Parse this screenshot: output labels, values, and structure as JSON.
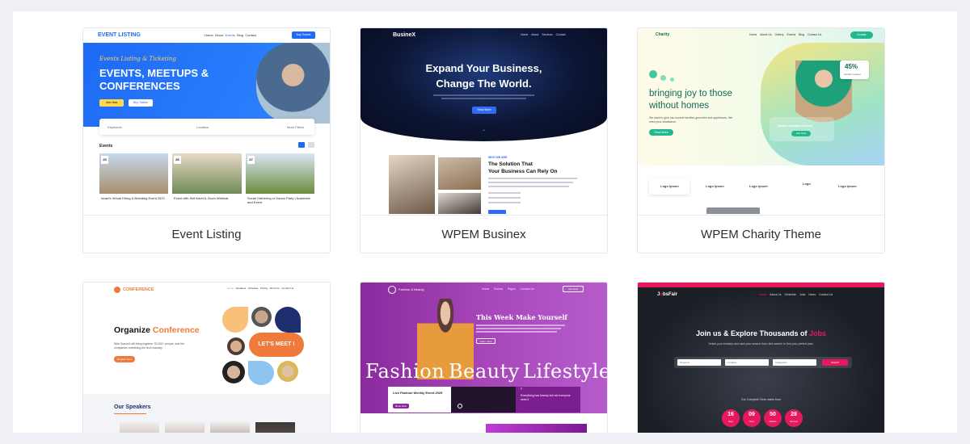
{
  "cards": [
    {
      "caption": "Event Listing",
      "logo": "EVENT LISTING",
      "nav": [
        "Home",
        "About",
        "Events",
        "Blog",
        "Contact"
      ],
      "nav_cta": "Buy Tickets",
      "tagline": "Events Listing & Ticketing",
      "headline": [
        "EVENTS, MEETUPS &",
        "CONFERENCES"
      ],
      "btn1": "Join Now",
      "btn2": "Buy Tickets",
      "search_keyword": "Keywords",
      "search_location": "Location",
      "search_filter": "More Filters",
      "section": "Events",
      "events": [
        {
          "day": "23",
          "title": "Israel's Virtual Hiring & Branding Event 2022"
        },
        {
          "day": "26",
          "title": "Event with Sell ticket & Zoom Webinar"
        },
        {
          "day": "27",
          "title": "Social Gathering or Dance Party | Academic and Event"
        }
      ]
    },
    {
      "caption": "WPEM Businex",
      "logo": "BusineX",
      "nav": [
        "Home",
        "About",
        "Services",
        "Contact"
      ],
      "headline": [
        "Expand Your Business,",
        "Change The World."
      ],
      "btn": "Read More",
      "eyebrow": "WHO WE ARE",
      "section_title": [
        "The Solution That",
        "Your Business Can Rely On"
      ]
    },
    {
      "caption": "WPEM Charity Theme",
      "logo": "Charity",
      "nav": [
        "Home",
        "About Us",
        "Gallery",
        "Events",
        "Blog",
        "Contact Us"
      ],
      "nav_cta": "Donate",
      "headline": [
        "bringing joy to those",
        "without homes"
      ],
      "sub": "We want to give low income families groceries and appliances. We need your assistance.",
      "btn": "Read More",
      "stat": "45%",
      "stat_label": "donation raised",
      "badge": "Online Donation Event",
      "badge_btn": "Join Now",
      "logos": [
        "Logo ipsum",
        "Logo ipsum",
        "Logo ipsum",
        "Logo",
        "Logo ipsum"
      ]
    },
    {
      "caption": "",
      "logo": "CONFERENCE",
      "nav": [
        "Home",
        "Speakers",
        "Schedule",
        "Pricing",
        "About Us",
        "Contact Us"
      ],
      "headline_a": "Organize",
      "headline_b": "Conference",
      "sub": "Web Summit will bring together 70,000+ people, and the companies redefining the tech industry.",
      "btn": "Register Now",
      "cta": "LET'S MEET !",
      "section": "Our Speakers"
    },
    {
      "caption": "",
      "logo": "Fashion & Beauty",
      "nav": [
        "Home",
        "Events",
        "Pages",
        "Contact Us"
      ],
      "nav_cta": "Join Now",
      "headline": "This Week Make Yourself",
      "btn": "Learn more",
      "big_words": [
        "Fashion",
        "Beauty",
        "Lifestyle"
      ],
      "event_title": "Live Fashion Weekly Event 2025",
      "event_btn": "Book Now",
      "quote": "Everything has beauty but not everyone sees it"
    },
    {
      "caption": "",
      "logo_a": "J",
      "logo_b": "bsFair",
      "nav": [
        "Home",
        "About Us",
        "Schedule",
        "Jobs",
        "News",
        "Contact Us"
      ],
      "headline_a": "Join us & Explore Thousands of",
      "headline_b": "Jobs",
      "sub": "Select your industry and start your search from click search to find your perfect jobs.",
      "fields": [
        "Keyword",
        "Location",
        "Categories"
      ],
      "search_btn": "Search",
      "countdown_label": "Our Complete Timer starts from",
      "countdown": [
        {
          "value": "16",
          "unit": "Days"
        },
        {
          "value": "09",
          "unit": "Hours"
        },
        {
          "value": "50",
          "unit": "Minutes"
        },
        {
          "value": "28",
          "unit": "Seconds"
        }
      ]
    }
  ]
}
